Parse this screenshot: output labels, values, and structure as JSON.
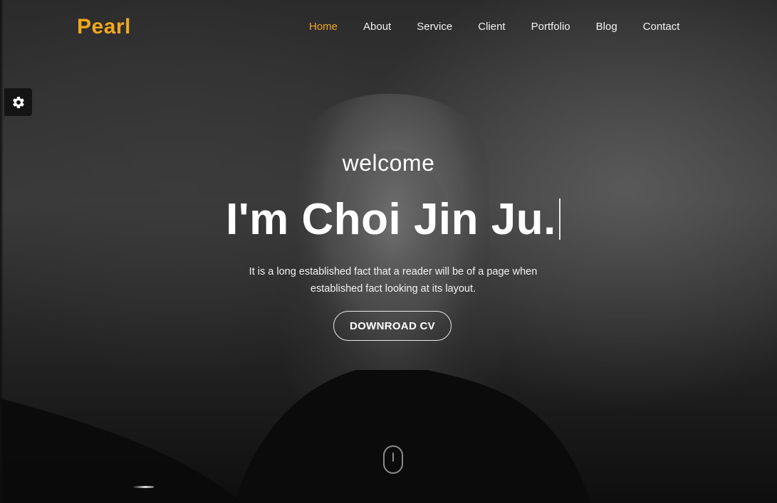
{
  "brand": {
    "name": "Pearl",
    "color": "#f0a81a"
  },
  "nav": {
    "items": [
      {
        "label": "Home",
        "active": true
      },
      {
        "label": "About",
        "active": false
      },
      {
        "label": "Service",
        "active": false
      },
      {
        "label": "Client",
        "active": false
      },
      {
        "label": "Portfolio",
        "active": false
      },
      {
        "label": "Blog",
        "active": false
      },
      {
        "label": "Contact",
        "active": false
      }
    ],
    "active_color": "#f0a81a",
    "text_color": "#f2f2f2"
  },
  "settings": {
    "icon": "gear-icon"
  },
  "hero": {
    "welcome": "welcome",
    "title": "I'm Choi Jin Ju.",
    "description_line1": "It is a long established fact that a reader will be of a page when",
    "description_line2": "established fact looking at its layout.",
    "cta_label": "DOWNROAD CV",
    "scroll_icon": "mouse-scroll-icon"
  }
}
